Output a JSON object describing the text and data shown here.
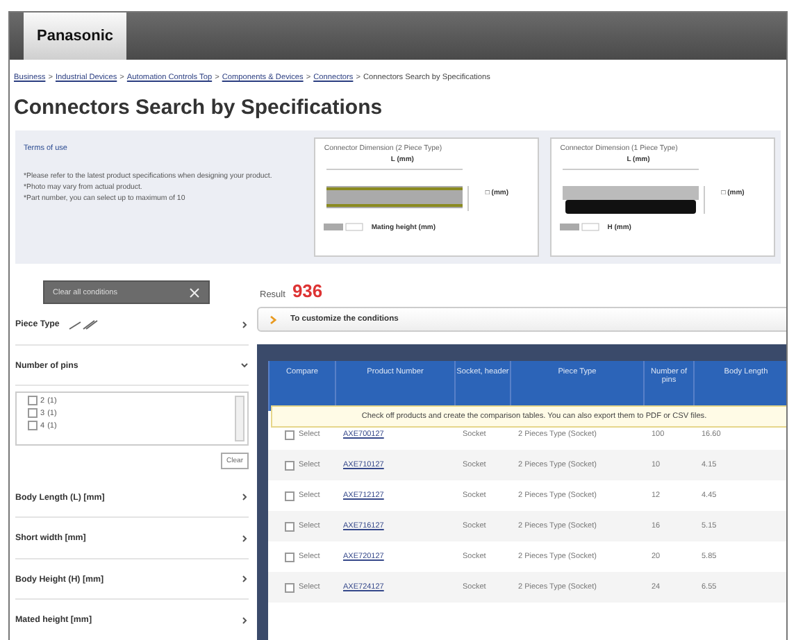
{
  "header": {
    "logo": "Panasonic"
  },
  "breadcrumb": [
    {
      "label": "Business",
      "link": true
    },
    {
      "separator": ">",
      "label": "Industrial Devices",
      "link": true
    },
    {
      "separator": ">",
      "label": "Automation Controls Top",
      "link": true
    },
    {
      "separator": ">",
      "label": "Components & Devices",
      "link": true
    },
    {
      "separator": ">",
      "label": "Connectors",
      "link": true
    },
    {
      "separator": ">",
      "label": "Connectors Search by Specifications",
      "link": false
    }
  ],
  "title": "Connectors Search by Specifications",
  "info": {
    "terms_link": "Terms of use",
    "notes": [
      "*Please refer to the latest product specifications when designing your product.",
      "*Photo may vary from actual product.",
      "*Part number, you can select up to maximum of 10"
    ],
    "diagrams": [
      {
        "kind": "two-piece",
        "title": "Connector Dimension (2 Piece Type)",
        "length_label": "L (mm)",
        "width_label": "□ (mm)",
        "height_label": "Mating height (mm)"
      },
      {
        "kind": "one-piece",
        "title": "Connector Dimension (1 Piece Type)",
        "length_label": "L (mm)",
        "width_label": "□ (mm)",
        "height_label": "H (mm)"
      }
    ]
  },
  "sidebar": {
    "clear_all": "Clear all conditions",
    "filters": [
      {
        "label": "Piece Type",
        "expanded": false,
        "icon": true
      },
      {
        "label": "Number of pins",
        "expanded": true,
        "options": [
          {
            "label": "2",
            "count": "(1)",
            "checked": false
          },
          {
            "label": "3",
            "count": "(1)",
            "checked": false
          },
          {
            "label": "4",
            "count": "(1)",
            "checked": false
          }
        ],
        "clear": "Clear"
      },
      {
        "label": "Body Length (L) [mm]",
        "expanded": false
      },
      {
        "label": "Short width [mm]",
        "expanded": false
      },
      {
        "label": "Body Height (H) [mm]",
        "expanded": false
      },
      {
        "label": "Mated height [mm]",
        "expanded": false
      }
    ]
  },
  "result": {
    "label": "Result",
    "count": "936"
  },
  "customize": "To customize the conditions",
  "table": {
    "columns": [
      "Compare",
      "Product Number",
      "Socket, header",
      "Piece Type",
      "Number of pins",
      "Body Length"
    ],
    "notice": "Check off products and create the comparison tables. You can also export them to PDF or CSV files.",
    "rows": [
      {
        "select": "Select",
        "checked": false,
        "product": "AXE700127",
        "socket": "Socket",
        "piece": "2 Pieces Type (Socket)",
        "pins": "100",
        "length": "16.60"
      },
      {
        "select": "Select",
        "checked": false,
        "product": "AXE710127",
        "socket": "Socket",
        "piece": "2 Pieces Type (Socket)",
        "pins": "10",
        "length": "4.15"
      },
      {
        "select": "Select",
        "checked": false,
        "product": "AXE712127",
        "socket": "Socket",
        "piece": "2 Pieces Type (Socket)",
        "pins": "12",
        "length": "4.45"
      },
      {
        "select": "Select",
        "checked": false,
        "product": "AXE716127",
        "socket": "Socket",
        "piece": "2 Pieces Type (Socket)",
        "pins": "16",
        "length": "5.15"
      },
      {
        "select": "Select",
        "checked": false,
        "product": "AXE720127",
        "socket": "Socket",
        "piece": "2 Pieces Type (Socket)",
        "pins": "20",
        "length": "5.85"
      },
      {
        "select": "Select",
        "checked": false,
        "product": "AXE724127",
        "socket": "Socket",
        "piece": "2 Pieces Type (Socket)",
        "pins": "24",
        "length": "6.55"
      }
    ]
  }
}
